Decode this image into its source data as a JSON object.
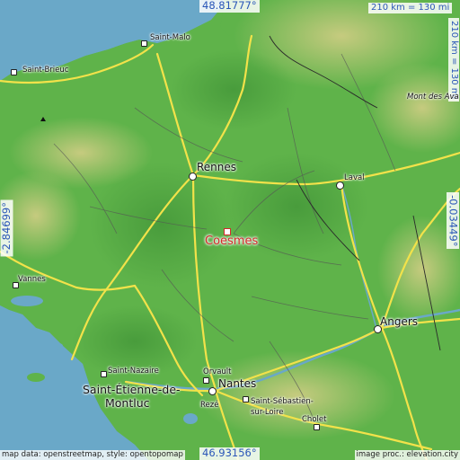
{
  "map": {
    "main_place": {
      "label": "Coesmes",
      "color": "#d42a2a"
    },
    "coords": {
      "top": "48.81777°",
      "bottom": "46.93156°",
      "left": "-2.84699°",
      "right": "-0.03449°"
    },
    "scale": {
      "horizontal": "210 km = 130 mi",
      "vertical": "210 km = 130 mi"
    },
    "places": [
      {
        "label": "Saint-Malo"
      },
      {
        "label": "Saint-Brieuc"
      },
      {
        "label": "Rennes"
      },
      {
        "label": "Laval"
      },
      {
        "label": "Vannes"
      },
      {
        "label": "Angers"
      },
      {
        "label": "Saint-Nazaire"
      },
      {
        "label": "Saint-Étienne-de-"
      },
      {
        "label": "Montluc"
      },
      {
        "label": "Orvault"
      },
      {
        "label": "Nantes"
      },
      {
        "label": "Rezé"
      },
      {
        "label": "Saint-Sébastien-"
      },
      {
        "label": "sur-Loire"
      },
      {
        "label": "Cholet"
      },
      {
        "label": "Mont des Ava"
      }
    ],
    "footer": {
      "left": "map data: openstreetmap, style: opentopomap",
      "right": "image proc.: elevation.city"
    },
    "colors": {
      "sea": "#6aa8c8",
      "land": "#5fb34a",
      "highland": "#c9c07a",
      "roads": "#f2e24a",
      "coord_text": "#2a56b8"
    }
  }
}
